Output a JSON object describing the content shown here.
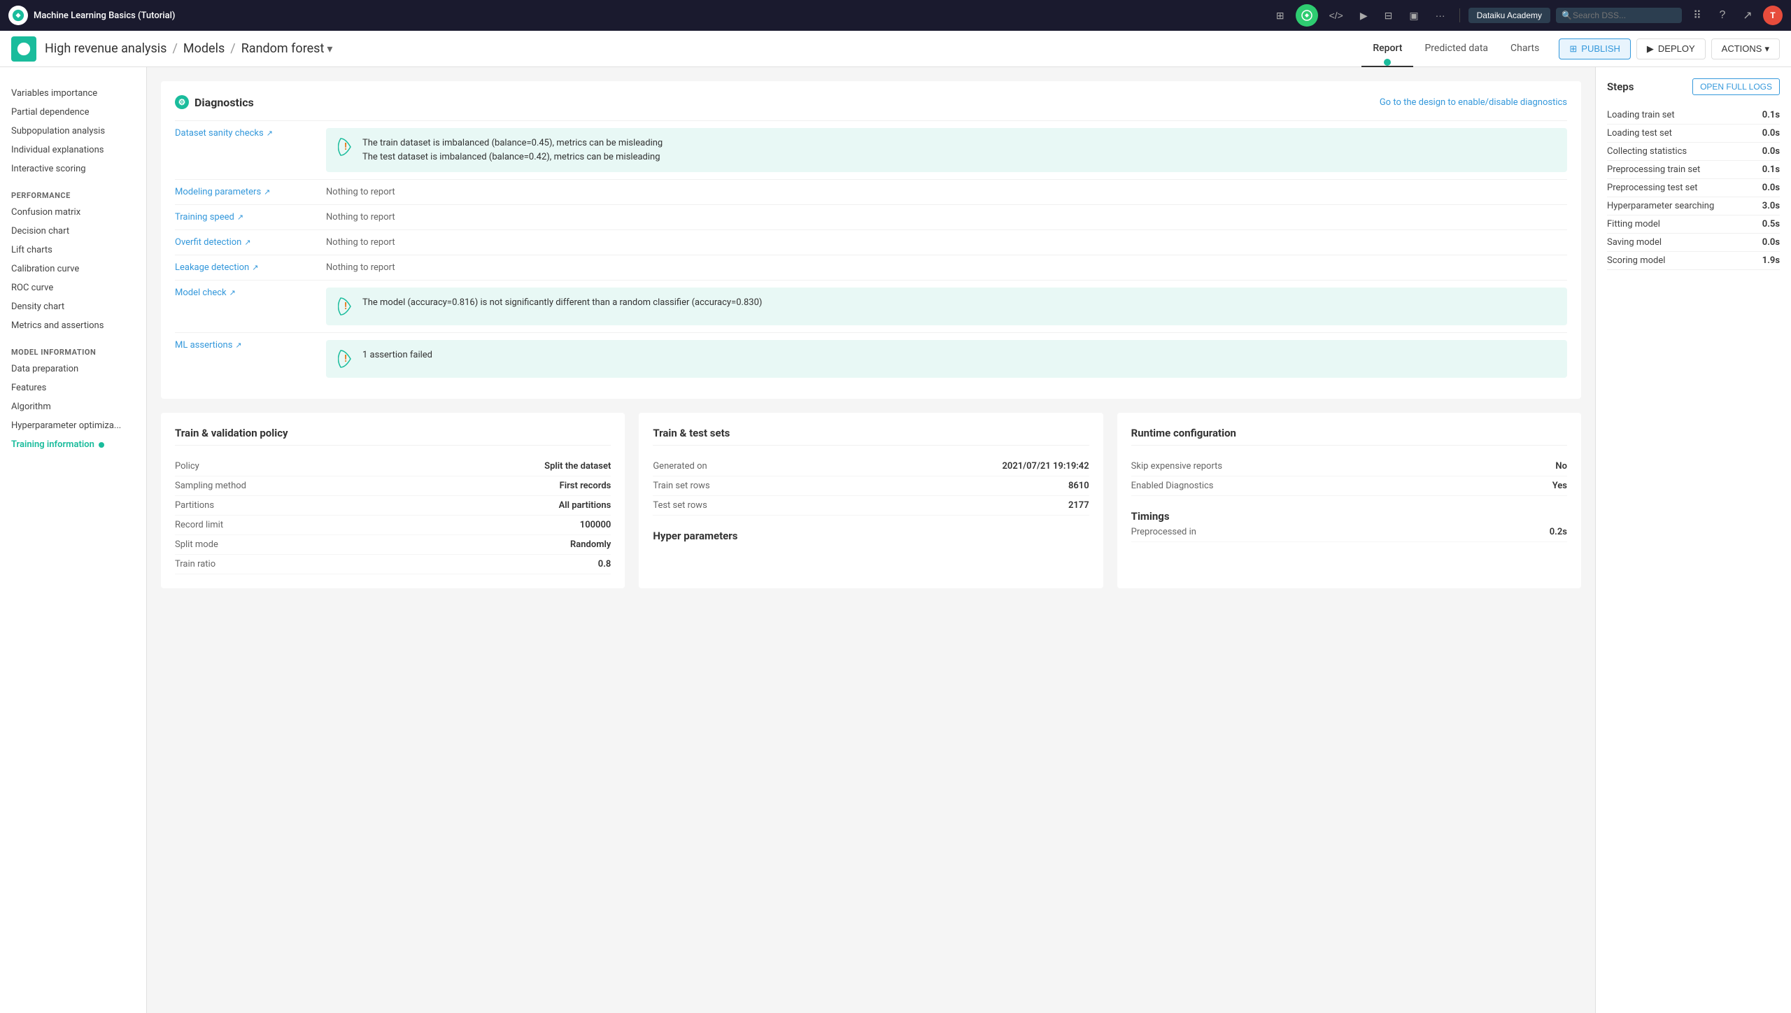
{
  "topbar": {
    "title": "Machine Learning Basics (Tutorial)",
    "academy_label": "Dataiku Academy",
    "search_placeholder": "Search DSS...",
    "avatar_text": "T"
  },
  "breadcrumb": {
    "project": "High revenue analysis",
    "models": "Models",
    "model": "Random forest"
  },
  "nav_tabs": [
    {
      "id": "report",
      "label": "Report",
      "active": true
    },
    {
      "id": "predicted_data",
      "label": "Predicted data",
      "active": false
    },
    {
      "id": "charts",
      "label": "Charts",
      "active": false
    }
  ],
  "buttons": {
    "publish": "PUBLISH",
    "deploy": "DEPLOY",
    "actions": "ACTIONS"
  },
  "sidebar": {
    "sections": [
      {
        "items": [
          {
            "id": "variables_importance",
            "label": "Variables importance",
            "active": false
          },
          {
            "id": "partial_dependence",
            "label": "Partial dependence",
            "active": false
          },
          {
            "id": "subpopulation_analysis",
            "label": "Subpopulation analysis",
            "active": false
          },
          {
            "id": "individual_explanations",
            "label": "Individual explanations",
            "active": false
          },
          {
            "id": "interactive_scoring",
            "label": "Interactive scoring",
            "active": false
          }
        ]
      },
      {
        "title": "PERFORMANCE",
        "items": [
          {
            "id": "confusion_matrix",
            "label": "Confusion matrix",
            "active": false
          },
          {
            "id": "decision_chart",
            "label": "Decision chart",
            "active": false
          },
          {
            "id": "lift_charts",
            "label": "Lift charts",
            "active": false
          },
          {
            "id": "calibration_curve",
            "label": "Calibration curve",
            "active": false
          },
          {
            "id": "roc_curve",
            "label": "ROC curve",
            "active": false
          },
          {
            "id": "density_chart",
            "label": "Density chart",
            "active": false
          },
          {
            "id": "metrics_assertions",
            "label": "Metrics and assertions",
            "active": false
          }
        ]
      },
      {
        "title": "MODEL INFORMATION",
        "items": [
          {
            "id": "data_preparation",
            "label": "Data preparation",
            "active": false
          },
          {
            "id": "features",
            "label": "Features",
            "active": false
          },
          {
            "id": "algorithm",
            "label": "Algorithm",
            "active": false
          },
          {
            "id": "hyperparameter_optim",
            "label": "Hyperparameter optimiza...",
            "active": false
          },
          {
            "id": "training_information",
            "label": "Training information",
            "active": true,
            "dot": true
          }
        ]
      }
    ]
  },
  "diagnostics": {
    "title": "Diagnostics",
    "link": "Go to the design to enable/disable diagnostics",
    "rows": [
      {
        "id": "dataset_sanity_checks",
        "label": "Dataset sanity checks",
        "type": "warning",
        "messages": [
          "The train dataset is imbalanced (balance=0.45), metrics can be misleading",
          "The test dataset is imbalanced (balance=0.42), metrics can be misleading"
        ]
      },
      {
        "id": "modeling_parameters",
        "label": "Modeling parameters",
        "type": "nothing",
        "message": "Nothing to report"
      },
      {
        "id": "training_speed",
        "label": "Training speed",
        "type": "nothing",
        "message": "Nothing to report"
      },
      {
        "id": "overfit_detection",
        "label": "Overfit detection",
        "type": "nothing",
        "message": "Nothing to report"
      },
      {
        "id": "leakage_detection",
        "label": "Leakage detection",
        "type": "nothing",
        "message": "Nothing to report"
      },
      {
        "id": "model_check",
        "label": "Model check",
        "type": "warning",
        "messages": [
          "The model (accuracy=0.816) is not significantly different than a random classifier (accuracy=0.830)"
        ]
      },
      {
        "id": "ml_assertions",
        "label": "ML assertions",
        "type": "warning",
        "messages": [
          "1 assertion failed"
        ]
      }
    ]
  },
  "steps": {
    "title": "Steps",
    "open_logs_label": "OPEN FULL LOGS",
    "items": [
      {
        "name": "Loading train set",
        "time": "0.1s"
      },
      {
        "name": "Loading test set",
        "time": "0.0s"
      },
      {
        "name": "Collecting statistics",
        "time": "0.0s"
      },
      {
        "name": "Preprocessing train set",
        "time": "0.1s"
      },
      {
        "name": "Preprocessing test set",
        "time": "0.0s"
      },
      {
        "name": "Hyperparameter searching",
        "time": "3.0s"
      },
      {
        "name": "Fitting model",
        "time": "0.5s"
      },
      {
        "name": "Saving model",
        "time": "0.0s"
      },
      {
        "name": "Scoring model",
        "time": "1.9s"
      }
    ]
  },
  "train_validation": {
    "title": "Train & validation policy",
    "rows": [
      {
        "key": "Policy",
        "value": "Split the dataset"
      },
      {
        "key": "Sampling method",
        "value": "First records"
      },
      {
        "key": "Partitions",
        "value": "All partitions"
      },
      {
        "key": "Record limit",
        "value": "100000"
      },
      {
        "key": "Split mode",
        "value": "Randomly"
      },
      {
        "key": "Train ratio",
        "value": "0.8"
      }
    ]
  },
  "train_test_sets": {
    "title": "Train & test sets",
    "rows": [
      {
        "key": "Generated on",
        "value": "2021/07/21 19:19:42"
      },
      {
        "key": "Train set rows",
        "value": "8610"
      },
      {
        "key": "Test set rows",
        "value": "2177"
      }
    ],
    "hyper_title": "Hyper parameters"
  },
  "runtime_config": {
    "title": "Runtime configuration",
    "rows": [
      {
        "key": "Skip expensive reports",
        "value": "No"
      },
      {
        "key": "Enabled Diagnostics",
        "value": "Yes"
      }
    ],
    "timings_title": "Timings",
    "timings_rows": [
      {
        "key": "Preprocessed in",
        "value": "0.2s"
      }
    ]
  }
}
